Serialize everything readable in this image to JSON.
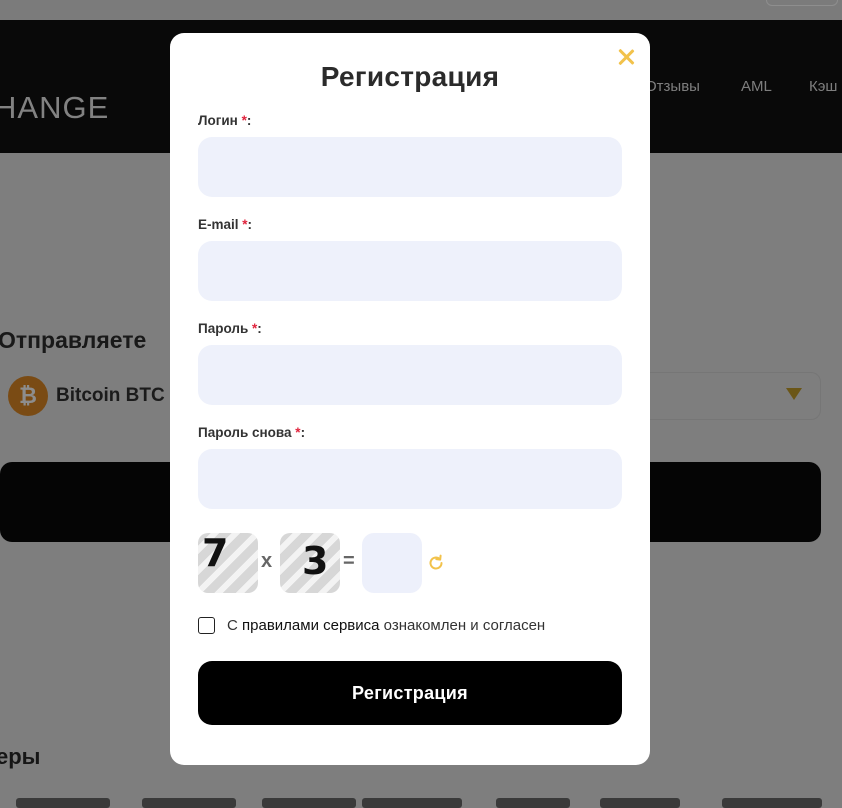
{
  "background": {
    "logo_text": "HANGE",
    "nav": [
      "Отзывы",
      "AML",
      "Кэш"
    ],
    "send_label": "Отправляете",
    "coin_symbol": "₿",
    "coin_name": "Bitcoin BTC",
    "partners_heading": "еры"
  },
  "modal": {
    "title": "Регистрация",
    "close_icon": "close-icon",
    "accent_color": "#f2c24b",
    "fields": [
      {
        "label": "Логин",
        "required_mark": "*",
        "suffix": ":",
        "value": ""
      },
      {
        "label": "E-mail",
        "required_mark": "*",
        "suffix": ":",
        "value": ""
      },
      {
        "label": "Пароль",
        "required_mark": "*",
        "suffix": ":",
        "value": ""
      },
      {
        "label": "Пароль снова",
        "required_mark": "*",
        "suffix": ":",
        "value": ""
      }
    ],
    "captcha": {
      "operand1": "7",
      "operator": "x",
      "operand2": "3",
      "equals": "=",
      "answer": "",
      "refresh_icon": "refresh-icon"
    },
    "agreement": {
      "checked": false,
      "text_before": "С",
      "link_text": "правилами сервиса",
      "text_after": "ознакомлен и согласен"
    },
    "submit_label": "Регистрация"
  }
}
